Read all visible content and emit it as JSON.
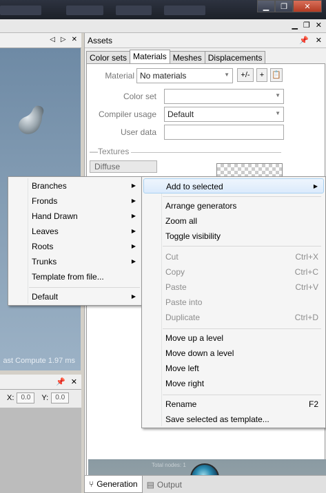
{
  "window": {
    "controls": [
      "minimize-icon",
      "restore-icon",
      "close-icon"
    ]
  },
  "viewport": {
    "last_compute": "ast Compute 1.97 ms"
  },
  "bottom_left": {
    "x_label": "X:",
    "x_value": "0.0",
    "y_label": "Y:",
    "y_value": "0.0"
  },
  "assets": {
    "title": "Assets",
    "tabs": [
      "Color sets",
      "Materials",
      "Meshes",
      "Displacements"
    ],
    "active_tab": "Materials",
    "material_label": "Material",
    "material_value": "No materials",
    "btn_plusminus": "+/-",
    "btn_plus": "+",
    "color_set_label": "Color set",
    "color_set_value": "",
    "compiler_usage_label": "Compiler usage",
    "compiler_usage_value": "Default",
    "user_data_label": "User data",
    "user_data_value": "",
    "textures_label": "Textures",
    "diffuse_label": "Diffuse",
    "preview_text": "Total nodes: 1"
  },
  "bottom_tabs": [
    {
      "label": "Generation",
      "icon": "generation-icon",
      "active": true
    },
    {
      "label": "Output",
      "icon": "output-icon",
      "active": false
    }
  ],
  "left_menu": {
    "items": [
      {
        "label": "Branches",
        "submenu": true
      },
      {
        "label": "Fronds",
        "submenu": true
      },
      {
        "label": "Hand Drawn",
        "submenu": true
      },
      {
        "label": "Leaves",
        "submenu": true
      },
      {
        "label": "Roots",
        "submenu": true
      },
      {
        "label": "Trunks",
        "submenu": true
      },
      {
        "label": "Template from file...",
        "submenu": false
      },
      {
        "label": "Default",
        "submenu": true
      }
    ]
  },
  "right_menu": {
    "items": [
      {
        "label": "Add to selected",
        "submenu": true,
        "highlight": true
      },
      {
        "label": "Arrange generators"
      },
      {
        "label": "Zoom all"
      },
      {
        "label": "Toggle visibility"
      },
      {
        "label": "Cut",
        "shortcut": "Ctrl+X",
        "disabled": true
      },
      {
        "label": "Copy",
        "shortcut": "Ctrl+C",
        "disabled": true
      },
      {
        "label": "Paste",
        "shortcut": "Ctrl+V",
        "disabled": true
      },
      {
        "label": "Paste into",
        "disabled": true
      },
      {
        "label": "Duplicate",
        "shortcut": "Ctrl+D",
        "disabled": true
      },
      {
        "label": "Move up a level"
      },
      {
        "label": "Move down a level"
      },
      {
        "label": "Move left"
      },
      {
        "label": "Move right"
      },
      {
        "label": "Rename",
        "shortcut": "F2"
      },
      {
        "label": "Save selected as template..."
      }
    ]
  }
}
